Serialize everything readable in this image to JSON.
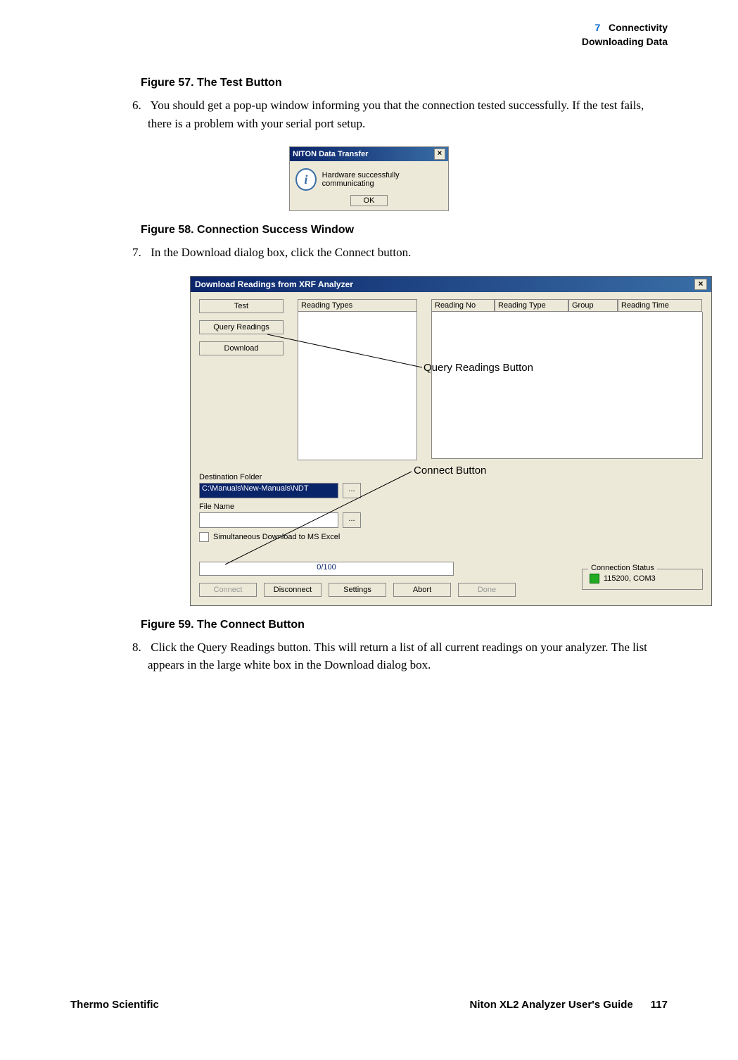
{
  "header": {
    "chapter_num": "7",
    "chapter": "Connectivity",
    "section": "Downloading Data"
  },
  "figures": {
    "f57": "Figure 57.   The Test Button",
    "f58": "Figure 58.   Connection Success Window",
    "f59": "Figure 59.   The Connect Button"
  },
  "steps": {
    "s6_num": "6.",
    "s6": "You should get a pop-up window informing you that the connection tested successfully. If the test fails, there is a problem with your serial port setup.",
    "s7_num": "7.",
    "s7": "In the Download dialog box, click the Connect button.",
    "s8_num": "8.",
    "s8": "Click the Query Readings button. This will return a list of all current readings on your analyzer. The list appears in the large white box in the Download dialog box."
  },
  "popup": {
    "title": "NITON Data Transfer",
    "message": "Hardware successfully communicating",
    "ok": "OK"
  },
  "dialog": {
    "title": "Download Readings from XRF Analyzer",
    "left_buttons": {
      "test": "Test",
      "query": "Query Readings",
      "download": "Download"
    },
    "reading_types_hdr": "Reading Types",
    "columns": {
      "c1": "Reading No",
      "c2": "Reading Type",
      "c3": "Group",
      "c4": "Reading Time"
    },
    "dest_label": "Destination Folder",
    "dest_value": "C:\\Manuals\\New-Manuals\\NDT",
    "file_label": "File Name",
    "file_value": "",
    "chk_label": "Simultaneous Download to MS Excel",
    "progress_text": "0/100",
    "conn_status_label": "Connection Status",
    "conn_status_value": "115200, COM3",
    "buttons": {
      "connect": "Connect",
      "disconnect": "Disconnect",
      "settings": "Settings",
      "abort": "Abort",
      "done": "Done"
    }
  },
  "annotations": {
    "query": "Query Readings Button",
    "connect": "Connect Button"
  },
  "footer": {
    "left": "Thermo Scientific",
    "right_title": "Niton XL2 Analyzer User's Guide",
    "page": "117"
  }
}
